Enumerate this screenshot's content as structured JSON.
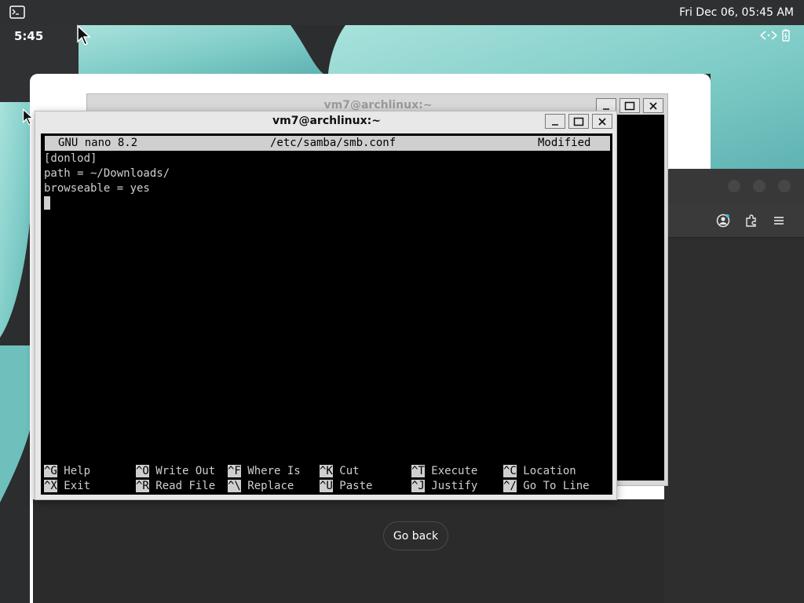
{
  "topbar": {
    "datetime": "Fri Dec 06, 05:45 AM"
  },
  "lockscreen": {
    "clock": "5:45"
  },
  "icons": {
    "terminal": "terminal-icon",
    "network": "network-icon",
    "battery": "battery-icon",
    "profile": "profile-icon",
    "extensions": "extensions-icon",
    "menu": "hamburger-menu-icon"
  },
  "dialog": {
    "go_back_label": "Go back"
  },
  "back_terminal": {
    "title": "vm7@archlinux:~"
  },
  "front_terminal": {
    "title": "vm7@archlinux:~",
    "nano": {
      "version": "GNU nano 8.2",
      "file": "/etc/samba/smb.conf",
      "state": "Modified",
      "lines": [
        "[donlod]",
        "path = ~/Downloads/",
        "browseable = yes"
      ],
      "shortcuts": [
        {
          "key": "^G",
          "label": "Help"
        },
        {
          "key": "^O",
          "label": "Write Out"
        },
        {
          "key": "^F",
          "label": "Where Is"
        },
        {
          "key": "^K",
          "label": "Cut"
        },
        {
          "key": "^T",
          "label": "Execute"
        },
        {
          "key": "^C",
          "label": "Location"
        },
        {
          "key": "^X",
          "label": "Exit"
        },
        {
          "key": "^R",
          "label": "Read File"
        },
        {
          "key": "^\\",
          "label": "Replace"
        },
        {
          "key": "^U",
          "label": "Paste"
        },
        {
          "key": "^J",
          "label": "Justify"
        },
        {
          "key": "^/",
          "label": "Go To Line"
        }
      ]
    }
  },
  "colors": {
    "wallpaper_teal": "#8fd3cf",
    "wallpaper_dark": "#2b2d2e",
    "terminal_bg": "#000000",
    "terminal_fg": "#cfcfcf"
  }
}
